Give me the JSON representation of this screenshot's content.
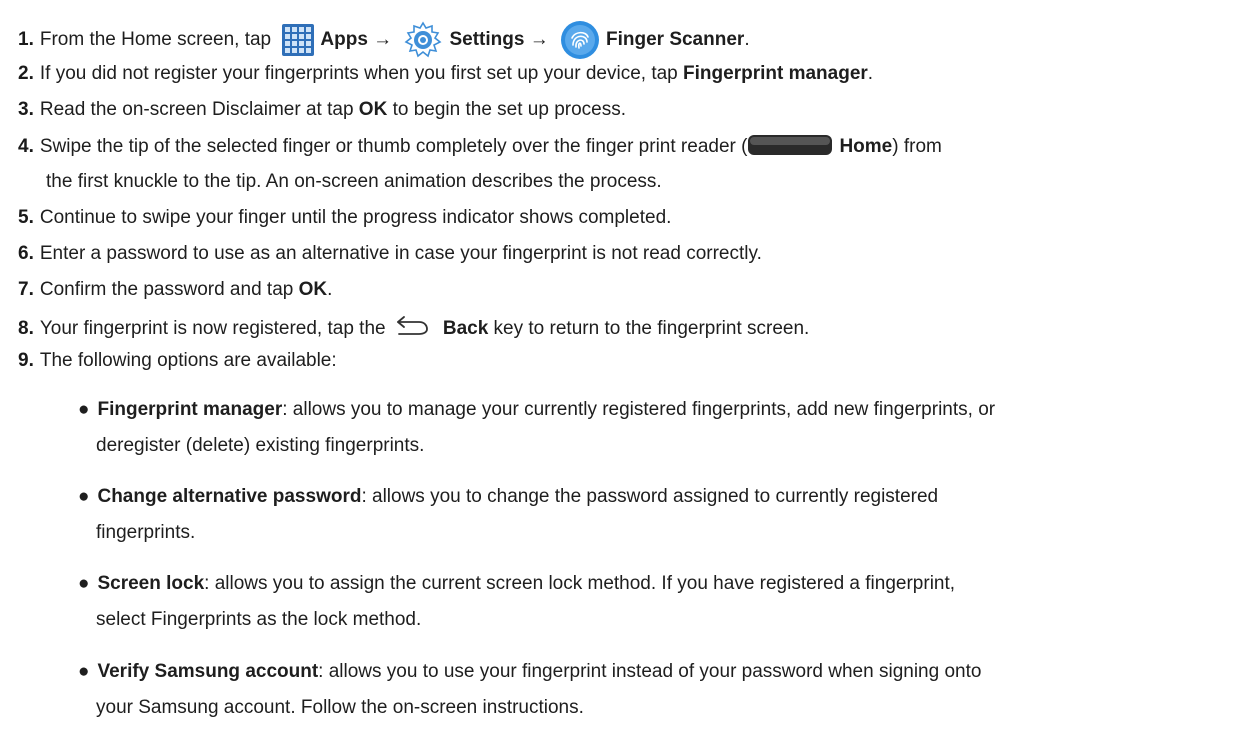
{
  "steps": [
    {
      "num": "1.",
      "pre": "From the Home screen, tap ",
      "apps": "Apps",
      "arrow1": " → ",
      "settings": "Settings",
      "arrow2": " → ",
      "finger": "Finger Scanner",
      "post": "."
    },
    {
      "num": "2.",
      "pre": "If you did not register your fingerprints when you first set up your device, tap ",
      "bold": "Fingerprint manager",
      "post": "."
    },
    {
      "num": "3.",
      "pre": "Read the on-screen Disclaimer at tap ",
      "bold": "OK",
      "post": " to begin the set up process."
    },
    {
      "num": "4.",
      "pre": "Swipe the tip of the selected finger or thumb completely over the finger print reader (",
      "bold": "Home",
      "post": ") from",
      "cont": "the first knuckle to the tip. An on-screen animation describes the process."
    },
    {
      "num": "5.",
      "text": "Continue to swipe your finger until the progress indicator shows completed."
    },
    {
      "num": "6.",
      "text": "Enter a password to use as an alternative in case your fingerprint is not read correctly."
    },
    {
      "num": "7.",
      "pre": "Confirm the password and tap ",
      "bold": "OK",
      "post": "."
    },
    {
      "num": "8.",
      "pre": "Your fingerprint is now registered, tap the ",
      "bold": "Back",
      "post": " key to return to the fingerprint screen."
    },
    {
      "num": "9.",
      "text": "The following options are available:"
    }
  ],
  "options": [
    {
      "bullet": "●",
      "title": "Fingerprint manager",
      "line1": ": allows you to manage your currently registered fingerprints, add new fingerprints, or",
      "line2": "deregister (delete) existing fingerprints."
    },
    {
      "bullet": "●",
      "title": "Change alternative password",
      "line1": ": allows you to change the password assigned to currently registered",
      "line2": "fingerprints."
    },
    {
      "bullet": "●",
      "title": "Screen lock",
      "line1": ": allows you to assign the current screen lock method. If you have registered a fingerprint,",
      "line2": "select Fingerprints as the lock method."
    },
    {
      "bullet": "●",
      "title": "Verify Samsung account",
      "line1": ": allows you to use your fingerprint instead of your password when signing onto",
      "line2": "your Samsung account. Follow the on-screen instructions."
    }
  ],
  "icons": {
    "apps": "apps-grid-icon",
    "settings": "settings-gear-icon",
    "finger_scanner": "fingerprint-icon",
    "home": "home-key-icon",
    "back": "back-arrow-icon"
  },
  "colors": {
    "apps_icon": "#3a7fc6",
    "settings_icon": "#3f8fd8",
    "finger_icon": "#2f8ee0",
    "home_key": "#2a2a2a",
    "text": "#1e1e1e"
  }
}
